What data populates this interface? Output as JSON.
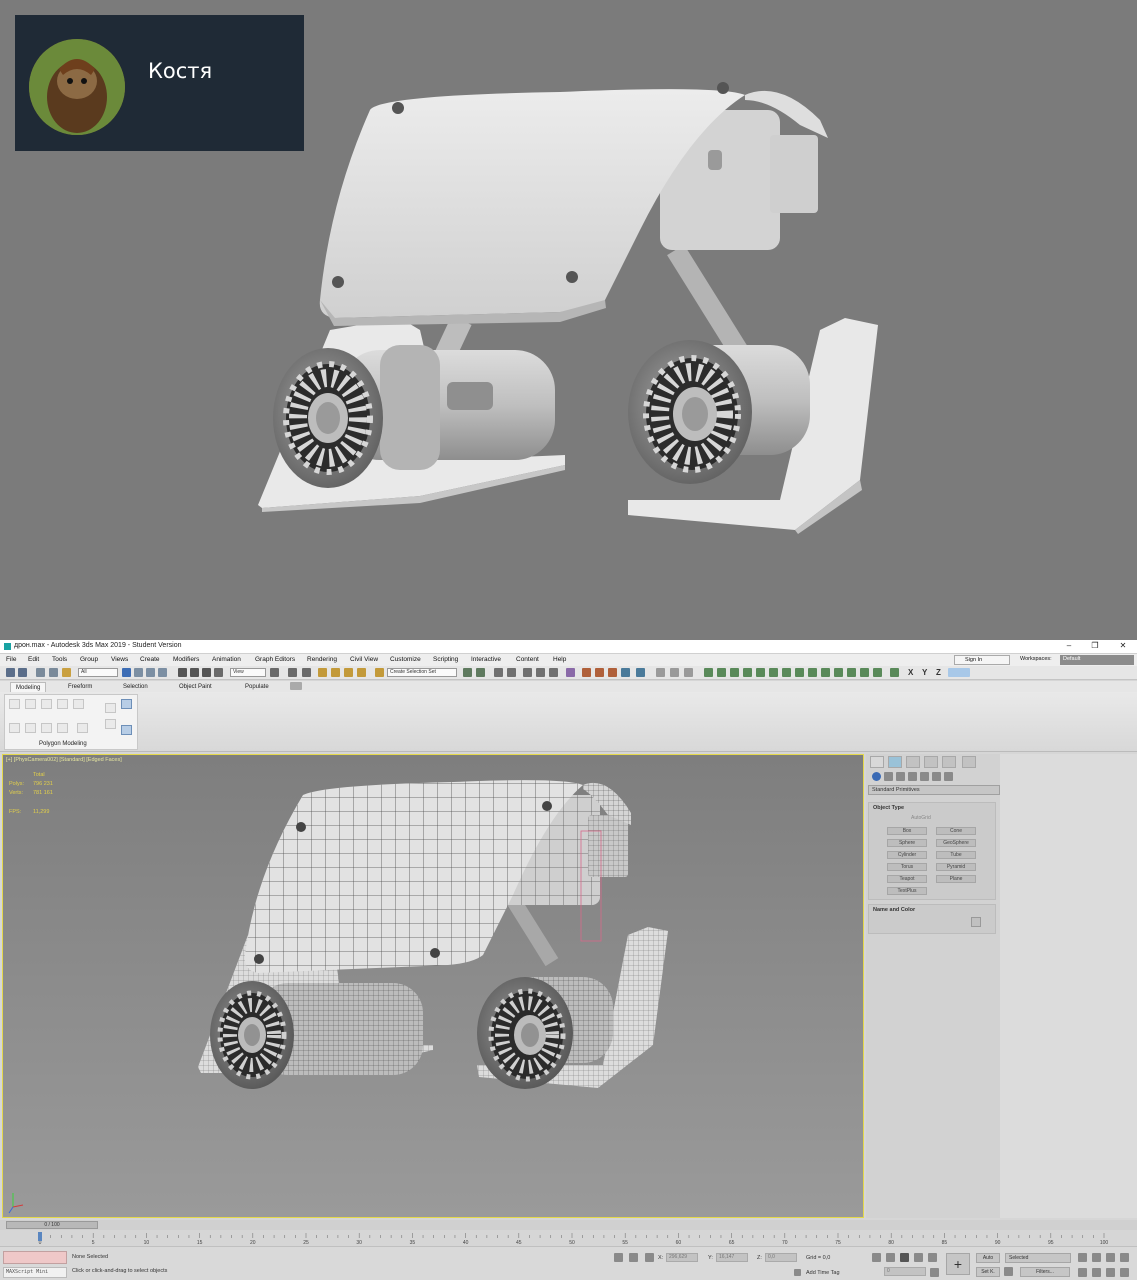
{
  "user": {
    "name": "Костя"
  },
  "window": {
    "title": "дрон.max - Autodesk 3ds Max 2019 - Student Version",
    "minimize": "–",
    "maximize": "❐",
    "close": "✕"
  },
  "menu": [
    "File",
    "Edit",
    "Tools",
    "Group",
    "Views",
    "Create",
    "Modifiers",
    "Animation",
    "Graph Editors",
    "Rendering",
    "Civil View",
    "Customize",
    "Scripting",
    "Interactive",
    "Content",
    "Help"
  ],
  "signin": "Sign In",
  "workspaces": {
    "label": "Workspaces:",
    "value": "Default"
  },
  "toolbar": {
    "filter": "All",
    "view": "View",
    "selection_set": "Create Selection Set",
    "axes": [
      "X",
      "Y",
      "Z"
    ]
  },
  "ribbon": {
    "tabs": [
      "Modeling",
      "Freeform",
      "Selection",
      "Object Paint",
      "Populate"
    ],
    "panel_label": "Polygon Modeling"
  },
  "viewport": {
    "label": "[+] [PhysCamera002] [Standard] [Edged Faces]",
    "stats": {
      "total": "Total",
      "polys_label": "Polys:",
      "polys": "796 231",
      "verts_label": "Verts:",
      "verts": "781 161",
      "fps_label": "FPS:",
      "fps": "11,299"
    }
  },
  "command_panel": {
    "primitive_type": "Standard Primitives",
    "object_type_title": "Object Type",
    "autogrid": "AutoGrid",
    "buttons": [
      "Box",
      "Cone",
      "Sphere",
      "GeoSphere",
      "Cylinder",
      "Tube",
      "Torus",
      "Pyramid",
      "Teapot",
      "Plane",
      "TextPlus"
    ],
    "name_color_title": "Name and Color"
  },
  "timeline": {
    "frame": "0 / 100",
    "ticks": [
      "0",
      "5",
      "10",
      "15",
      "20",
      "25",
      "30",
      "35",
      "40",
      "45",
      "50",
      "55",
      "60",
      "65",
      "70",
      "75",
      "80",
      "85",
      "90",
      "95",
      "100"
    ]
  },
  "status": {
    "maxscript": "MAXScript Mini",
    "selection": "None Selected",
    "prompt": "Click or click-and-drag to select objects",
    "x_label": "X:",
    "x_value": "296,629",
    "y_label": "Y:",
    "y_value": "16,147",
    "z_label": "Z:",
    "z_value": "0,0",
    "grid": "Grid = 0,0",
    "add_time_tag": "Add Time Tag",
    "auto": "Auto",
    "set_k": "Set K.",
    "selected": "Selected",
    "filters": "Filters...",
    "frame_field": "0"
  },
  "colors": {
    "viewport_border": "#e4d84a",
    "title_accent": "#19a3a3",
    "stat_text": "#e3d04a"
  }
}
